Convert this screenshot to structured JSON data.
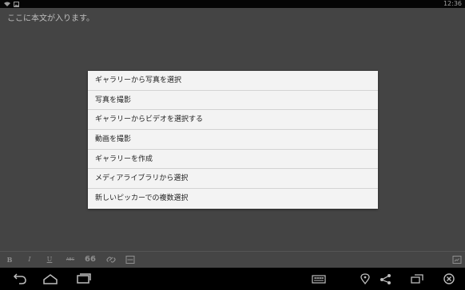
{
  "status_bar": {
    "time": "12:36",
    "icons": [
      "wifi-icon",
      "image-icon"
    ]
  },
  "editor": {
    "content_text": "ここに本文が入ります。",
    "background": "#444444"
  },
  "menu": {
    "items": [
      {
        "label": "ギャラリーから写真を選択"
      },
      {
        "label": "写真を撮影"
      },
      {
        "label": "ギャラリーからビデオを選択する"
      },
      {
        "label": "動画を撮影"
      },
      {
        "label": "ギャラリーを作成"
      },
      {
        "label": "メディアライブラリから選択"
      },
      {
        "label": "新しいピッカーでの複数選択"
      }
    ]
  },
  "format_toolbar": {
    "bold": "B",
    "italic": "I",
    "underline": "U",
    "strikethrough": "ABC",
    "quote": "66",
    "link_icon": "link-icon",
    "more_icon": "more-icon",
    "right_icon": "preview-icon"
  },
  "nav_bar": {
    "icons": [
      "back-icon",
      "home-icon",
      "recents-icon",
      "keyboard-icon",
      "location-icon",
      "share-icon",
      "window-icon",
      "close-icon"
    ]
  }
}
